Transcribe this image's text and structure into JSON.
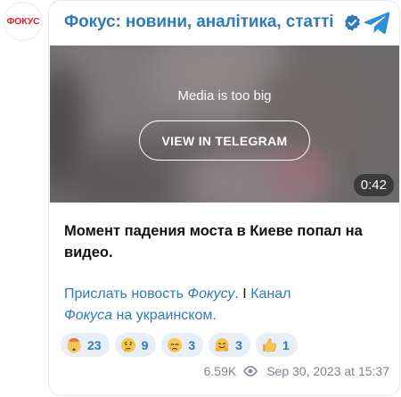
{
  "avatar": {
    "logo_text": "ФОКУС"
  },
  "header": {
    "channel_title": "Фокус: новини, аналітика, статті",
    "verified_icon": "verified-check-icon",
    "telegram_icon": "telegram-plane-icon"
  },
  "media": {
    "notice": "Media is too big",
    "view_button": "VIEW IN TELEGRAM",
    "duration": "0:42"
  },
  "post": {
    "text": "Момент падения моста в Киеве попал на видео.",
    "link_part1": "Прислать новость ",
    "link_part1_italic": "Фокусу",
    "link_part1_end": ".",
    "separator": " I ",
    "link_part2": "Канал",
    "link_part2_italic": "Фокуса",
    "link_part2_end": " на украинском."
  },
  "reactions": [
    {
      "emoji": "exploding-head",
      "count": "23"
    },
    {
      "emoji": "thinking-face",
      "count": "9"
    },
    {
      "emoji": "crying-face",
      "count": "3"
    },
    {
      "emoji": "hugging-face",
      "count": "3"
    },
    {
      "emoji": "thumbs-up",
      "count": "1"
    }
  ],
  "meta": {
    "views": "6.59K",
    "timestamp": "Sep 30, 2023 at 15:37"
  },
  "colors": {
    "accent": "#2f7ab8",
    "brand_red": "#e0202a",
    "reaction_bg": "#e7eef5",
    "muted": "#7d8690"
  }
}
